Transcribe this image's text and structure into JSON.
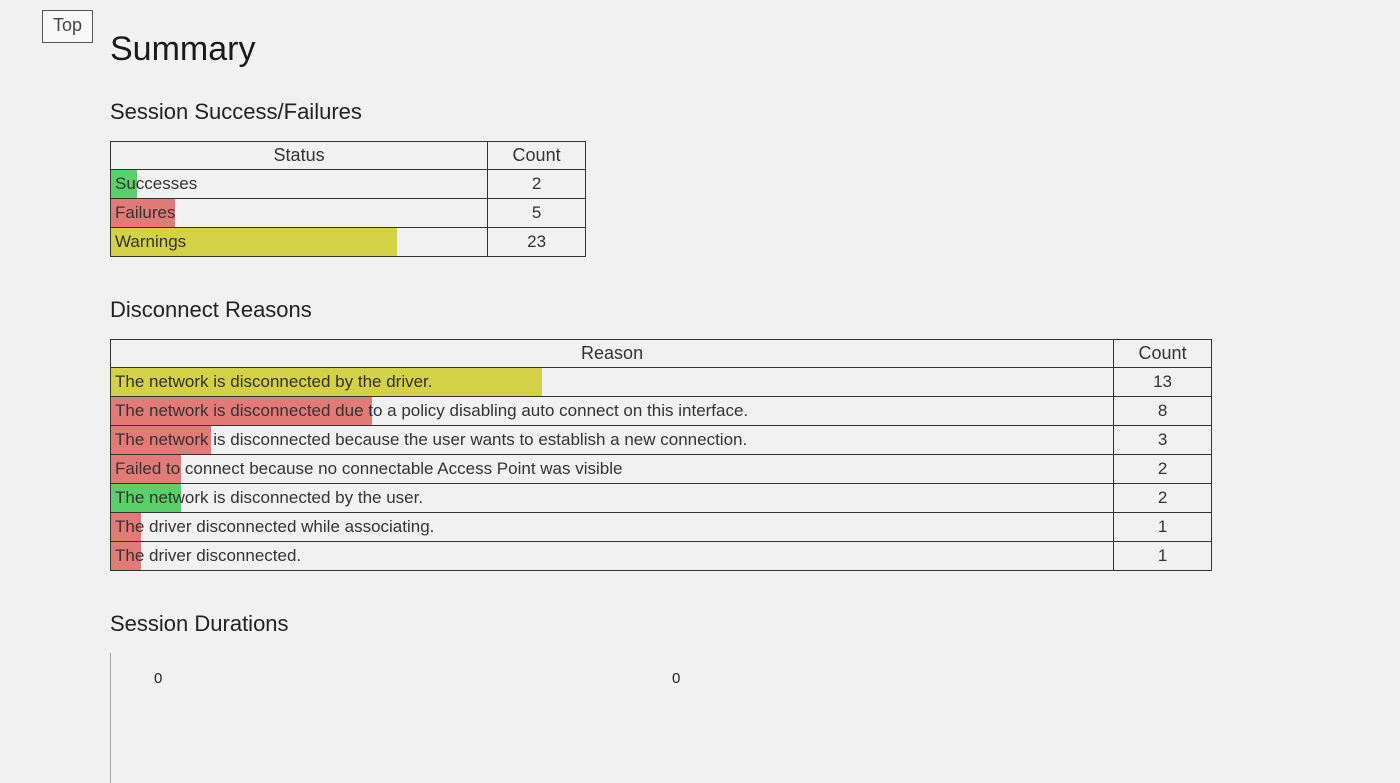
{
  "top_link": "Top",
  "title": "Summary",
  "sections": {
    "status": {
      "heading": "Session Success/Failures",
      "col_status": "Status",
      "col_count": "Count",
      "rows": [
        {
          "label": "Successes",
          "count": 2,
          "color": "#5bcf6a",
          "fill_pct": 7
        },
        {
          "label": "Failures",
          "count": 5,
          "color": "#e27a78",
          "fill_pct": 17
        },
        {
          "label": "Warnings",
          "count": 23,
          "color": "#d4d147",
          "fill_pct": 76
        }
      ]
    },
    "reasons": {
      "heading": "Disconnect Reasons",
      "col_reason": "Reason",
      "col_count": "Count",
      "rows": [
        {
          "label": "The network is disconnected by the driver.",
          "count": 13,
          "color": "#d4d147",
          "fill_pct": 43
        },
        {
          "label": "The network is disconnected due to a policy disabling auto connect on this interface.",
          "count": 8,
          "color": "#e27a78",
          "fill_pct": 26
        },
        {
          "label": "The network is disconnected because the user wants to establish a new connection.",
          "count": 3,
          "color": "#e27a78",
          "fill_pct": 10
        },
        {
          "label": "Failed to connect because no connectable Access Point was visible",
          "count": 2,
          "color": "#e27a78",
          "fill_pct": 7
        },
        {
          "label": "The network is disconnected by the user.",
          "count": 2,
          "color": "#5bcf6a",
          "fill_pct": 7
        },
        {
          "label": "The driver disconnected while associating.",
          "count": 1,
          "color": "#e27a78",
          "fill_pct": 3
        },
        {
          "label": "The driver disconnected.",
          "count": 1,
          "color": "#e27a78",
          "fill_pct": 3
        }
      ]
    },
    "durations": {
      "heading": "Session Durations",
      "tick0": "0",
      "tick1": "0"
    }
  },
  "chart_data": [
    {
      "type": "bar",
      "title": "Session Success/Failures",
      "categories": [
        "Successes",
        "Failures",
        "Warnings"
      ],
      "values": [
        2,
        5,
        23
      ],
      "colors": [
        "#5bcf6a",
        "#e27a78",
        "#d4d147"
      ]
    },
    {
      "type": "bar",
      "title": "Disconnect Reasons",
      "categories": [
        "The network is disconnected by the driver.",
        "The network is disconnected due to a policy disabling auto connect on this interface.",
        "The network is disconnected because the user wants to establish a new connection.",
        "Failed to connect because no connectable Access Point was visible",
        "The network is disconnected by the user.",
        "The driver disconnected while associating.",
        "The driver disconnected."
      ],
      "values": [
        13,
        8,
        3,
        2,
        2,
        1,
        1
      ],
      "colors": [
        "#d4d147",
        "#e27a78",
        "#e27a78",
        "#e27a78",
        "#5bcf6a",
        "#e27a78",
        "#e27a78"
      ]
    }
  ]
}
